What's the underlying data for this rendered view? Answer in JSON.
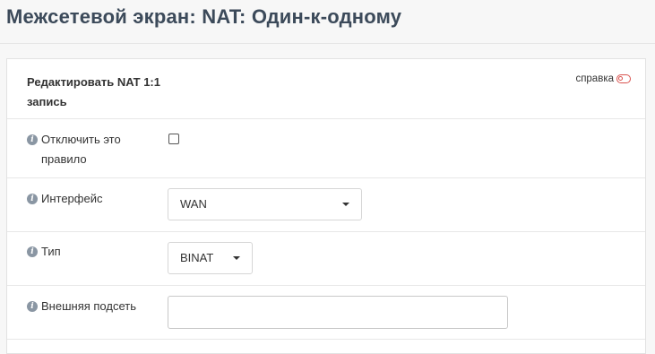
{
  "page": {
    "title": "Межсетевой экран: NAT: Один-к-одному"
  },
  "panel": {
    "title": "Редактировать NAT 1:1 запись",
    "help_label": "справка",
    "help_icon": "toggle-icon",
    "accent_color": "#d9534f"
  },
  "form": {
    "disable": {
      "label": "Отключить это правило",
      "checked": false
    },
    "interface": {
      "label": "Интерфейс",
      "value": "WAN"
    },
    "type": {
      "label": "Тип",
      "value": "BINAT"
    },
    "external_subnet": {
      "label": "Внешняя подсеть",
      "value": ""
    }
  }
}
